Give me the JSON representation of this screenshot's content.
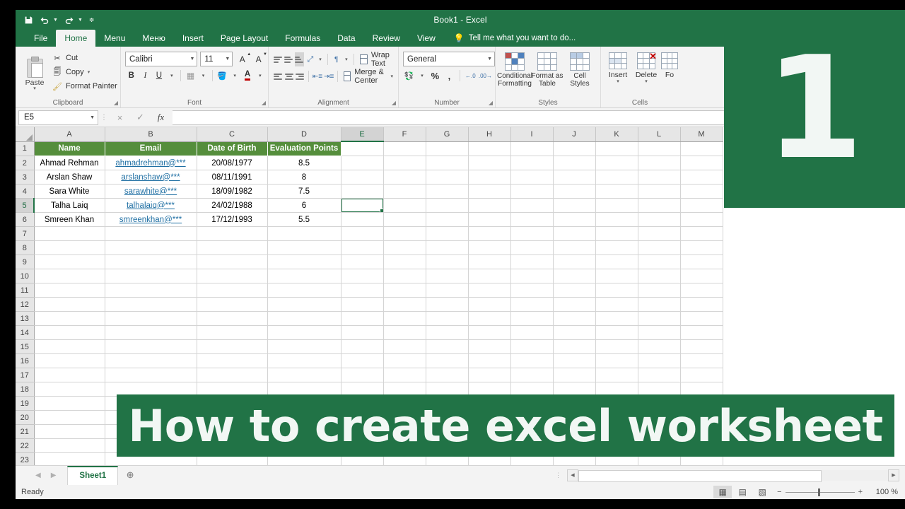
{
  "titlebar": {
    "title": "Book1 - Excel",
    "qat": [
      {
        "name": "save-icon",
        "glyph": "💾"
      },
      {
        "name": "undo-icon",
        "glyph": "↶"
      },
      {
        "name": "redo-icon",
        "glyph": "↷"
      },
      {
        "name": "customize-qat-icon",
        "glyph": "≣"
      }
    ]
  },
  "ribbon": {
    "tabs": [
      {
        "label": "File",
        "active": false
      },
      {
        "label": "Home",
        "active": true
      },
      {
        "label": "Menu",
        "active": false
      },
      {
        "label": "Меню",
        "active": false
      },
      {
        "label": "Insert",
        "active": false
      },
      {
        "label": "Page Layout",
        "active": false
      },
      {
        "label": "Formulas",
        "active": false
      },
      {
        "label": "Data",
        "active": false
      },
      {
        "label": "Review",
        "active": false
      },
      {
        "label": "View",
        "active": false
      }
    ],
    "tell_me": "Tell me what you want to do...",
    "groups": {
      "clipboard": {
        "label": "Clipboard",
        "paste": "Paste",
        "cut": "Cut",
        "copy": "Copy",
        "format_painter": "Format Painter"
      },
      "font": {
        "label": "Font",
        "font_name": "Calibri",
        "font_size": "11",
        "bold": "B",
        "italic": "I",
        "underline": "U",
        "grow_font": "A",
        "shrink_font": "A"
      },
      "alignment": {
        "label": "Alignment",
        "wrap_text": "Wrap Text",
        "merge_center": "Merge & Center"
      },
      "number": {
        "label": "Number",
        "format": "General",
        "percent": "%",
        "comma": ","
      },
      "styles": {
        "label": "Styles",
        "conditional_formatting": "Conditional Formatting",
        "format_as_table": "Format as Table",
        "cell_styles": "Cell Styles"
      },
      "cells": {
        "label": "Cells",
        "insert": "Insert",
        "delete": "Delete",
        "format": "Fo"
      }
    }
  },
  "formula_bar": {
    "name_box": "E5",
    "cancel": "×",
    "enter": "✓",
    "fx": "fx",
    "formula_value": ""
  },
  "sheet": {
    "columns": [
      "A",
      "B",
      "C",
      "D",
      "E",
      "F",
      "G",
      "H",
      "I",
      "J",
      "K",
      "L",
      "M"
    ],
    "rows": [
      "1",
      "2",
      "3",
      "4",
      "5",
      "6",
      "7",
      "8",
      "9",
      "10",
      "11",
      "12",
      "13",
      "14",
      "15",
      "16",
      "17",
      "18",
      "19",
      "20",
      "21",
      "22",
      "23"
    ],
    "selected_cell": "E5",
    "selected_column": "E",
    "selected_row": "5",
    "header_fill": "#558e3c",
    "headers": [
      "Name",
      "Email",
      "Date of Birth",
      "Evaluation Points"
    ],
    "data": [
      {
        "name": "Ahmad Rehman",
        "email": "ahmadrehman@***",
        "dob": "20/08/1977",
        "points": "8.5"
      },
      {
        "name": "Arslan Shaw",
        "email": "arslanshaw@***",
        "dob": "08/11/1991",
        "points": "8"
      },
      {
        "name": "Sara White",
        "email": "sarawhite@***",
        "dob": "18/09/1982",
        "points": "7.5"
      },
      {
        "name": "Talha Laiq",
        "email": "talhalaiq@***",
        "dob": "24/02/1988",
        "points": "6"
      },
      {
        "name": "Smreen Khan",
        "email": "smreenkhan@***",
        "dob": "17/12/1993",
        "points": "5.5"
      }
    ]
  },
  "sheet_tabs": {
    "prev": "◀",
    "next": "▶",
    "tabs": [
      {
        "label": "Sheet1",
        "active": true
      }
    ],
    "add": "⊕"
  },
  "status_bar": {
    "ready": "Ready",
    "views": [
      {
        "name": "normal-view-icon",
        "glyph": "▦",
        "active": true
      },
      {
        "name": "page-layout-view-icon",
        "glyph": "▤",
        "active": false
      },
      {
        "name": "page-break-view-icon",
        "glyph": "▧",
        "active": false
      }
    ],
    "zoom_out": "−",
    "zoom_in": "+",
    "zoom_level": "100 %"
  },
  "overlays": {
    "step_number": "1",
    "banner_text": "How to create excel worksheet",
    "brand_green": "#217346"
  }
}
